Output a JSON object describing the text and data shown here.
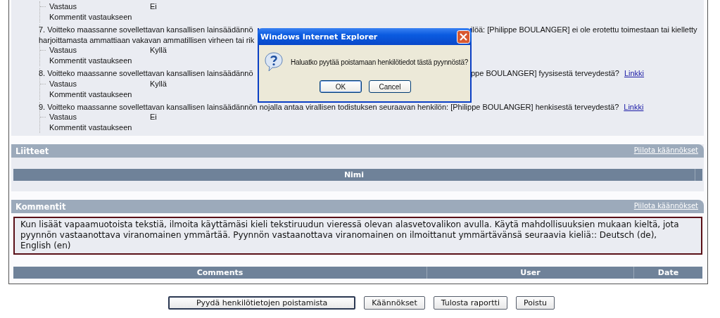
{
  "questions": [
    {
      "answer_label": "Vastaus",
      "answer": "Ei",
      "comment_label": "Kommentit vastaukseen"
    },
    {
      "lines": [
        {
          "left": "7. Voitteko maassanne sovellettavan kansallisen lainsäädännö",
          "right": "ilöä: [Philippe BOULANGER] ei ole erotettu toimestaan tai kielletty"
        },
        {
          "left": "harjoittamasta ammattiaan vakavan ammatillisen virheen tai rik"
        }
      ],
      "answer_label": "Vastaus",
      "answer": "Kyllä",
      "comment_label": "Kommentit vastaukseen"
    },
    {
      "lines": [
        {
          "left": "8. Voitteko maassanne sovellettavan kansallisen lainsäädännö",
          "right": "ppe BOULANGER] fyysisestä terveydestä?",
          "link": "Linkki"
        }
      ],
      "answer_label": "Vastaus",
      "answer": "Kyllä",
      "comment_label": "Kommentit vastaukseen"
    },
    {
      "lines": [
        {
          "full": "9. Voitteko maassanne sovellettavan kansallisen lainsäädännön nojalla antaa virallisen todistuksen seuraavan henkilön: [Philippe BOULANGER] henkisestä terveydestä?",
          "link": "Linkki"
        }
      ],
      "answer_label": "Vastaus",
      "answer": "Ei",
      "comment_label": "Kommentit vastaukseen"
    }
  ],
  "sections": [
    {
      "kind": "attachments",
      "title": "Liitteet",
      "toggle": "Piilota käännökset",
      "columns": [
        "Nimi"
      ]
    },
    {
      "kind": "comments",
      "title": "Kommentit",
      "toggle": "Piilota käännökset",
      "notice": "Kun lisäät vapaamuotoista tekstiä, ilmoita käyttämäsi kieli tekstiruudun vieressä olevan alasvetovalikon avulla. Käytä mahdollisuuksien mukaan kieltä, jota pyynnön vastaanottava viranomainen ymmärtää. Pyynnön vastaanottava viranomainen on ilmoittanut ymmärtävänsä seuraavia kieliä:: Deutsch (de), English (en)",
      "columns": [
        "Comments",
        "User",
        "Date"
      ]
    }
  ],
  "buttons": [
    {
      "label": "Pyydä henkilötietojen poistamista",
      "focused": true
    },
    {
      "label": "Käännökset",
      "focused": false
    },
    {
      "label": "Tulosta raportti",
      "focused": false
    },
    {
      "label": "Poistu",
      "focused": false
    }
  ],
  "dialog": {
    "title": "Windows Internet Explorer",
    "message": "Haluatko pyytää poistamaan henkilötiedot tästä pyynnöstä?",
    "buttons": [
      {
        "label": "OK",
        "focused": true
      },
      {
        "label": "Cancel",
        "focused": false
      }
    ]
  }
}
